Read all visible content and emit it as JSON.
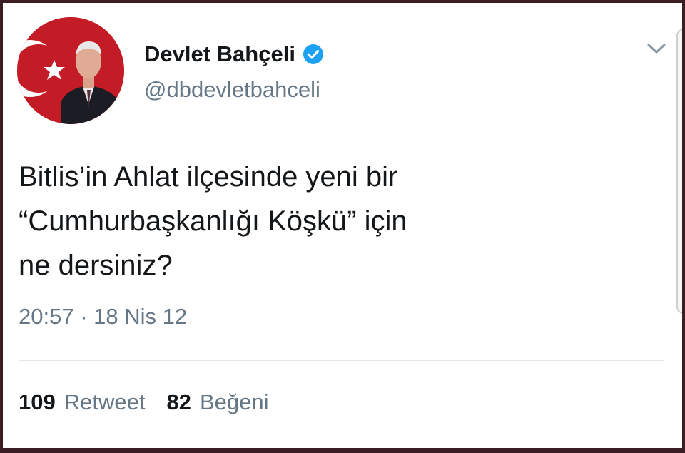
{
  "author": {
    "display_name": "Devlet Bahçeli",
    "handle": "@dbdevletbahceli",
    "verified": true,
    "avatar_icon": "profile-photo"
  },
  "tweet": {
    "lines": [
      "Bitlis’in Ahlat ilçesinde yeni bir",
      "“Cumhurbaşkanlığı Köşkü” için",
      "ne dersiniz?"
    ],
    "timestamp": "20:57 · 18 Nis 12"
  },
  "stats": {
    "retweets_count": "109",
    "retweets_label": "Retweet",
    "likes_count": "82",
    "likes_label": "Beğeni"
  },
  "colors": {
    "text_primary": "#14171a",
    "text_secondary": "#657786",
    "verified_blue": "#1da1f2",
    "flag_red": "#c41c26",
    "frame": "#3a1e24"
  }
}
